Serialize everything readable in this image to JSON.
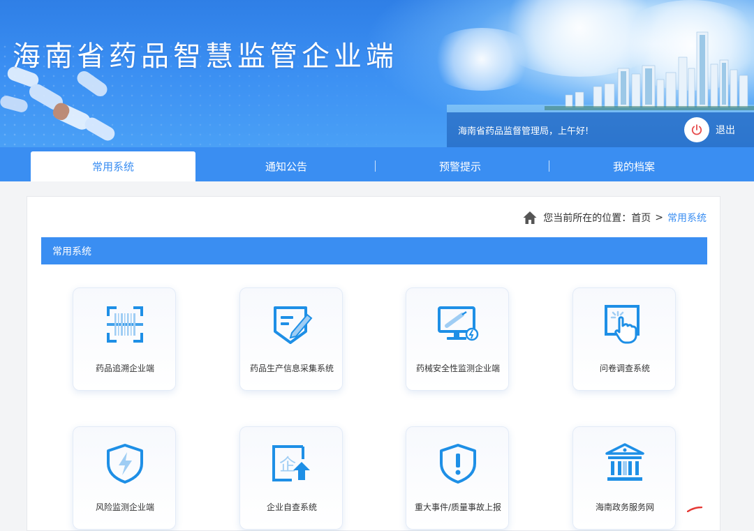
{
  "header": {
    "title": "海南省药品智慧监管企业端",
    "greeting": "海南省药品监督管理局，上午好!",
    "logout_label": "退出",
    "logout_icon": "power-icon"
  },
  "tabs": [
    {
      "label": "常用系统",
      "active": true
    },
    {
      "label": "通知公告",
      "active": false
    },
    {
      "label": "预警提示",
      "active": false
    },
    {
      "label": "我的档案",
      "active": false
    }
  ],
  "breadcrumb": {
    "prefix": "您当前所在的位置：",
    "home": "首页",
    "separator": ">",
    "current": "常用系统"
  },
  "section": {
    "title": "常用系统"
  },
  "apps": [
    {
      "label": "药品追溯企业端",
      "icon": "barcode-scan-icon"
    },
    {
      "label": "药品生产信息采集系统",
      "icon": "form-edit-icon"
    },
    {
      "label": "药械安全性监测企业端",
      "icon": "monitor-syringe-icon"
    },
    {
      "label": "问卷调查系统",
      "icon": "touch-screen-icon"
    },
    {
      "label": "风险监测企业端",
      "icon": "shield-lightning-icon"
    },
    {
      "label": "企业自查系统",
      "icon": "enterprise-upload-icon"
    },
    {
      "label": "重大事件/质量事故上报",
      "icon": "shield-alert-icon"
    },
    {
      "label": "海南政务服务网",
      "icon": "government-building-icon"
    }
  ],
  "colors": {
    "primary": "#3a8ef2",
    "icon_blue": "#1e8fe6",
    "panel_bg": "#ffffff",
    "page_bg": "#f3f4f6"
  }
}
